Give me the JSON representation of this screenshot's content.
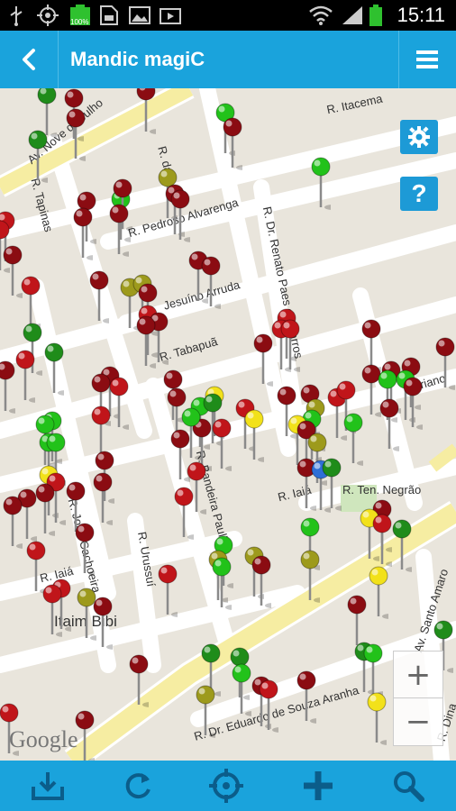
{
  "status": {
    "time": "15:11",
    "battery_label": "100%"
  },
  "app": {
    "title": "Mandic magiC"
  },
  "map": {
    "labels": [
      {
        "text": "Av. Nove de Julho",
        "cls": "l1"
      },
      {
        "text": "R. Itacema",
        "cls": "l2"
      },
      {
        "text": "R. Tapinas",
        "cls": "l3"
      },
      {
        "text": "R. da",
        "cls": "l4"
      },
      {
        "text": "R. Pedroso Alvarenga",
        "cls": "l5"
      },
      {
        "text": "R. Dr. Renato Paes de Barros",
        "cls": "l6"
      },
      {
        "text": "Jesuíno Arruda",
        "cls": "l7"
      },
      {
        "text": "R. Tabapuã",
        "cls": "l8"
      },
      {
        "text": "Floriano",
        "cls": "l9"
      },
      {
        "text": "R. Bandeira Paulista",
        "cls": "l10"
      },
      {
        "text": "R. Iaiá",
        "cls": "l11"
      },
      {
        "text": "R. Ten. Negrão",
        "cls": "l12"
      },
      {
        "text": "R. João Cachoeira",
        "cls": "l13"
      },
      {
        "text": "R. Urussuí",
        "cls": "l14"
      },
      {
        "text": "R. Iaiá",
        "cls": "l15"
      },
      {
        "text": "Itaim Bibi",
        "cls": "l16"
      },
      {
        "text": "Av. Santo Amaro",
        "cls": "l17"
      },
      {
        "text": "R. Dr. Eduardo de Souza Aranha",
        "cls": "l18"
      },
      {
        "text": "R. Dina",
        "cls": "l19"
      }
    ],
    "google_logo": "Google",
    "zoom_in": "+",
    "zoom_out": "−",
    "help_label": "?"
  },
  "pins": {
    "colors": {
      "red": "#c0151a",
      "darkred": "#8b0c12",
      "green": "#22c21a",
      "darkgreen": "#1f8c1a",
      "yellow": "#f2e11a",
      "olive": "#9d9a1c"
    }
  },
  "toolbar": {
    "items": [
      "download",
      "refresh",
      "locate",
      "add",
      "search"
    ]
  }
}
